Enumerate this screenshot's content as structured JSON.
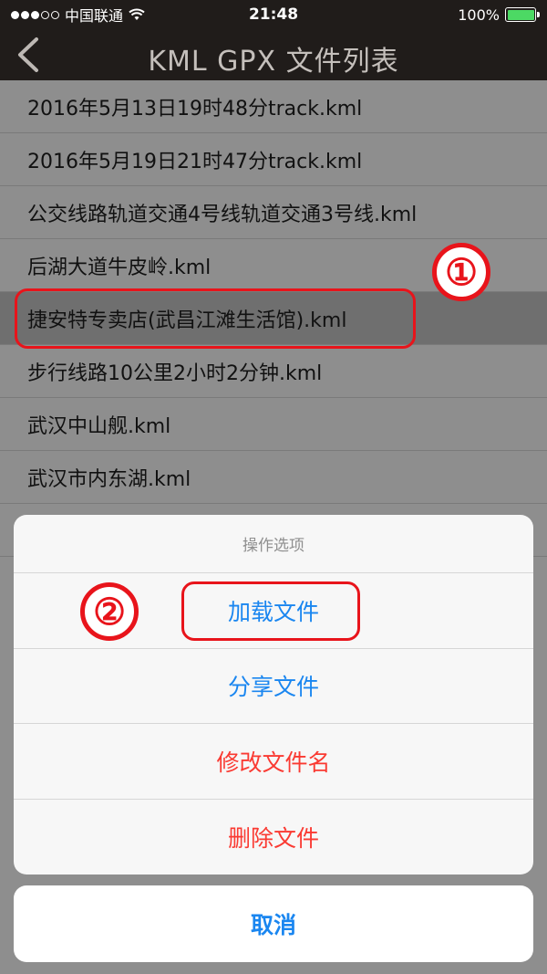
{
  "status_bar": {
    "carrier": "中国联通",
    "time": "21:48",
    "battery_text": "100%"
  },
  "nav": {
    "title": "KML GPX 文件列表",
    "back_icon": "chevron-left-icon"
  },
  "files": [
    "2016年5月13日19时48分track.kml",
    "2016年5月19日21时47分track.kml",
    "公交线路轨道交通4号线轨道交通3号线.kml",
    "后湖大道牛皮岭.kml",
    "捷安特专卖店(武昌江滩生活馆).kml",
    "步行线路10公里2小时2分钟.kml",
    "武汉中山舰.kml",
    "武汉市内东湖.kml"
  ],
  "selected_index": 4,
  "annotations": {
    "step1": "①",
    "step2": "②",
    "color": "#e8141b"
  },
  "action_sheet": {
    "title": "操作选项",
    "load": "加载文件",
    "share": "分享文件",
    "rename": "修改文件名",
    "delete": "删除文件",
    "cancel": "取消"
  },
  "colors": {
    "accent": "#1a86f0",
    "danger": "#fa3a32",
    "battery": "#4cd964"
  }
}
